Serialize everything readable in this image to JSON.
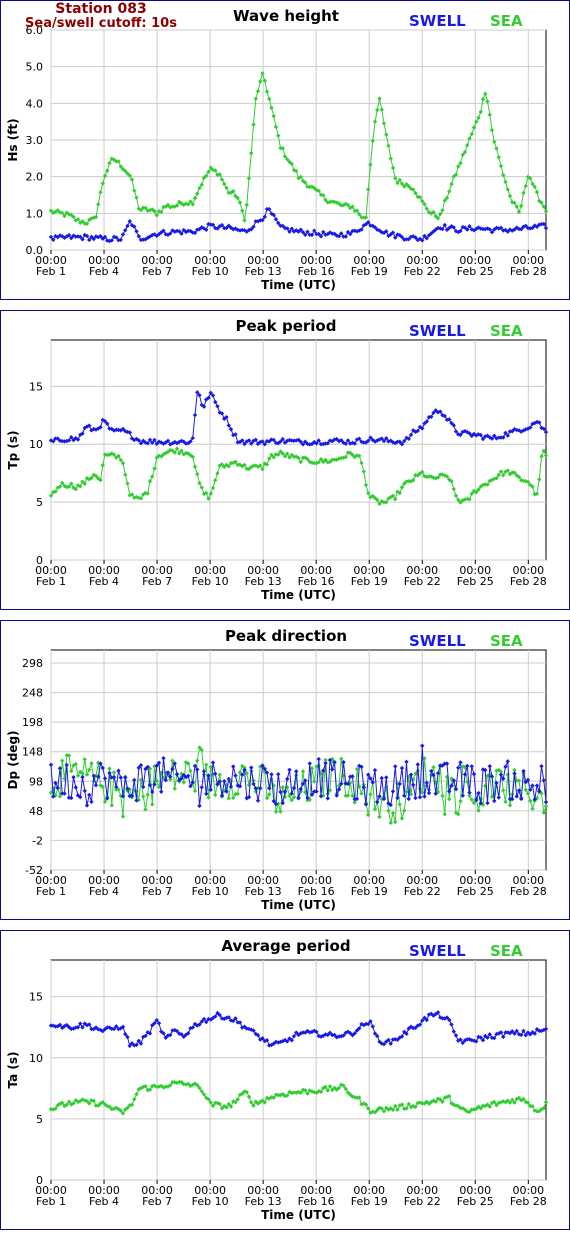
{
  "station": {
    "name": "Station 083",
    "cutoff": "Sea/swell cutoff: 10s"
  },
  "legend": {
    "swell": "SWELL",
    "sea": "SEA",
    "swell_color": "#1a1ae6",
    "sea_color": "#33cc33"
  },
  "x_axis": {
    "label": "Time (UTC)",
    "ticks": [
      {
        "time": "00:00",
        "date": "Feb 1",
        "day": 0
      },
      {
        "time": "00:00",
        "date": "Feb 4",
        "day": 3
      },
      {
        "time": "00:00",
        "date": "Feb 7",
        "day": 6
      },
      {
        "time": "00:00",
        "date": "Feb 10",
        "day": 9
      },
      {
        "time": "00:00",
        "date": "Feb 13",
        "day": 12
      },
      {
        "time": "00:00",
        "date": "Feb 16",
        "day": 15
      },
      {
        "time": "00:00",
        "date": "Feb 19",
        "day": 18
      },
      {
        "time": "00:00",
        "date": "Feb 22",
        "day": 21
      },
      {
        "time": "00:00",
        "date": "Feb 25",
        "day": 24
      },
      {
        "time": "00:00",
        "date": "Feb 28",
        "day": 27
      }
    ],
    "range_days": [
      0,
      28
    ]
  },
  "chart_data": [
    {
      "type": "line",
      "title": "Wave height",
      "ylabel": "Hs (ft)",
      "ylim": [
        0,
        6
      ],
      "yticks": [
        "0.0",
        "1.0",
        "2.0",
        "3.0",
        "4.0",
        "5.0",
        "6.0"
      ],
      "ytick_values": [
        0,
        1,
        2,
        3,
        4,
        5,
        6
      ],
      "grid": true,
      "legend": "top-right",
      "series": [
        {
          "name": "SWELL",
          "x": [
            0,
            1,
            2,
            3,
            4,
            4.5,
            5,
            6,
            7,
            8,
            9,
            10,
            11,
            12,
            12.3,
            13,
            14,
            15,
            16,
            17,
            18,
            19,
            20,
            21,
            22,
            23,
            24,
            25,
            26,
            27,
            28
          ],
          "values": [
            0.3,
            0.35,
            0.35,
            0.3,
            0.3,
            0.8,
            0.3,
            0.45,
            0.5,
            0.5,
            0.65,
            0.6,
            0.5,
            0.9,
            1.1,
            0.6,
            0.5,
            0.45,
            0.4,
            0.45,
            0.75,
            0.45,
            0.35,
            0.3,
            0.65,
            0.55,
            0.6,
            0.55,
            0.55,
            0.6,
            0.65
          ]
        },
        {
          "name": "SEA",
          "x": [
            0,
            0.5,
            1,
            1.5,
            2,
            2.5,
            3,
            3.5,
            4,
            4.5,
            5,
            5.5,
            6,
            6.5,
            7,
            7.5,
            8,
            8.5,
            9,
            9.5,
            10,
            10.5,
            11,
            11.3,
            11.6,
            12,
            12.3,
            12.6,
            13,
            13.5,
            14,
            14.5,
            15,
            15.5,
            16,
            16.5,
            17,
            17.4,
            17.8,
            18,
            18.3,
            18.6,
            19,
            19.5,
            20,
            20.5,
            21,
            21.5,
            22,
            22.5,
            23,
            23.5,
            24,
            24.3,
            24.6,
            25,
            25.5,
            26,
            26.5,
            27,
            27.5,
            28
          ],
          "values": [
            1.05,
            1.0,
            0.95,
            0.8,
            0.75,
            0.85,
            2.0,
            2.5,
            2.3,
            2.0,
            1.1,
            1.1,
            1.0,
            1.2,
            1.2,
            1.3,
            1.3,
            1.8,
            2.2,
            2.1,
            1.6,
            1.5,
            0.8,
            2.5,
            4.2,
            4.8,
            4.2,
            3.6,
            2.8,
            2.4,
            2.0,
            1.8,
            1.6,
            1.4,
            1.3,
            1.2,
            1.2,
            1.0,
            0.8,
            2.0,
            3.5,
            4.1,
            3.0,
            1.9,
            1.8,
            1.7,
            1.3,
            1.0,
            0.9,
            1.6,
            2.2,
            2.8,
            3.4,
            3.8,
            4.4,
            3.1,
            2.2,
            1.4,
            1.0,
            2.1,
            1.5,
            1.1
          ]
        }
      ]
    },
    {
      "type": "line",
      "title": "Peak period",
      "ylabel": "Tp (s)",
      "ylim": [
        0,
        19
      ],
      "yticks": [
        "0",
        "5",
        "10",
        "15"
      ],
      "ytick_values": [
        0,
        5,
        10,
        15
      ],
      "grid": true,
      "legend": "top-right",
      "series": [
        {
          "name": "SWELL",
          "x": [
            0,
            1,
            1.5,
            2,
            2.5,
            3,
            3.5,
            4,
            4.5,
            5,
            6,
            7,
            8,
            8.3,
            8.6,
            9,
            9.5,
            10,
            10.3,
            10.6,
            11,
            12,
            13,
            14,
            15,
            16,
            17,
            18,
            19,
            20,
            20.5,
            21,
            21.5,
            22,
            22.5,
            23,
            24,
            25,
            26,
            27,
            27.5,
            28
          ],
          "values": [
            10.2,
            10.5,
            10.4,
            11.5,
            11.2,
            12,
            11,
            11.2,
            10.8,
            10.3,
            10.2,
            10.2,
            10.2,
            15,
            13,
            14.5,
            13,
            12,
            11,
            10.3,
            10.2,
            10.2,
            10.3,
            10.2,
            10.2,
            10.3,
            10.2,
            10.4,
            10.3,
            10.2,
            11,
            11.5,
            12.5,
            13,
            12,
            11,
            10.8,
            10.5,
            11,
            11.5,
            12,
            11
          ]
        },
        {
          "name": "SEA",
          "x": [
            0,
            0.5,
            1,
            1.5,
            2,
            2.5,
            2.8,
            3,
            3.5,
            4,
            4.5,
            5,
            5.5,
            6,
            7,
            8,
            8.3,
            8.6,
            9,
            9.5,
            10,
            10.5,
            11,
            12,
            12.5,
            13,
            14,
            15,
            16,
            17,
            17.5,
            18,
            18.5,
            19,
            19.5,
            20,
            20.5,
            21,
            21.5,
            22,
            22.5,
            23,
            23.5,
            24,
            24.5,
            25,
            25.5,
            26,
            26.5,
            27,
            27.5,
            27.8,
            28
          ],
          "values": [
            5.5,
            6.5,
            6.5,
            6.3,
            6.8,
            7.5,
            6.8,
            9,
            9,
            8.8,
            5.5,
            5.2,
            6,
            9,
            9.5,
            9.2,
            7,
            5.8,
            5.4,
            8,
            8.2,
            8.5,
            8.0,
            8.0,
            9,
            9.2,
            8.7,
            8.5,
            8.6,
            9.2,
            8.8,
            5.5,
            5.0,
            5.0,
            5.5,
            6.5,
            7.0,
            7.5,
            7.0,
            7.2,
            7.2,
            5.2,
            5.0,
            6.0,
            6.5,
            7.0,
            7.5,
            7.6,
            7.0,
            6.8,
            5.5,
            9.5,
            9.0
          ]
        }
      ]
    },
    {
      "type": "scatter",
      "title": "Peak direction",
      "ylabel": "Dp (deg)",
      "ylim": [
        -52,
        320
      ],
      "yticks": [
        "-52",
        "-2",
        "48",
        "98",
        "148",
        "198",
        "248",
        "298"
      ],
      "ytick_values": [
        -52,
        -2,
        48,
        98,
        148,
        198,
        248,
        298
      ],
      "grid": true,
      "legend": "top-right",
      "series": [
        {
          "name": "SWELL",
          "x": [
            0,
            1,
            2,
            3,
            4,
            5,
            6,
            7,
            8,
            9,
            10,
            11,
            12,
            13,
            14,
            15,
            16,
            17,
            18,
            19,
            20,
            21,
            22,
            23,
            24,
            25,
            26,
            27,
            28
          ],
          "values": [
            95,
            100,
            90,
            105,
            85,
            100,
            110,
            95,
            105,
            100,
            110,
            95,
            100,
            85,
            100,
            105,
            100,
            95,
            90,
            85,
            100,
            105,
            95,
            100,
            90,
            95,
            100,
            85,
            95
          ]
        },
        {
          "name": "SEA",
          "x": [
            0,
            1,
            2,
            3,
            4,
            5,
            6,
            7,
            8,
            9,
            10,
            11,
            12,
            13,
            14,
            15,
            16,
            17,
            18,
            19,
            20,
            21,
            22,
            23,
            24,
            25,
            26,
            27,
            28
          ],
          "values": [
            100,
            110,
            105,
            95,
            75,
            70,
            100,
            105,
            110,
            95,
            100,
            110,
            90,
            60,
            80,
            95,
            110,
            100,
            70,
            60,
            65,
            110,
            100,
            75,
            70,
            90,
            85,
            80,
            70
          ]
        }
      ]
    },
    {
      "type": "line",
      "title": "Average period",
      "ylabel": "Ta (s)",
      "ylim": [
        0,
        18
      ],
      "yticks": [
        "0",
        "5",
        "10",
        "15"
      ],
      "ytick_values": [
        0,
        5,
        10,
        15
      ],
      "grid": true,
      "legend": "top-right",
      "series": [
        {
          "name": "SWELL",
          "x": [
            0,
            1,
            2,
            3,
            4,
            4.5,
            5,
            5.5,
            6,
            6.5,
            7,
            7.5,
            8,
            8.5,
            9,
            9.5,
            10,
            10.5,
            11,
            11.5,
            12,
            12.5,
            13,
            13.5,
            14,
            15,
            16,
            17,
            17.5,
            18,
            18.5,
            19,
            19.5,
            20,
            20.5,
            21,
            21.5,
            22,
            22.5,
            23,
            23.5,
            24,
            25,
            26,
            27,
            28
          ],
          "values": [
            12.8,
            12.5,
            12.7,
            12.2,
            12.6,
            11.0,
            11.2,
            12.0,
            13.0,
            11.5,
            12.2,
            11.8,
            12.5,
            13.0,
            13.2,
            13.5,
            13.3,
            13.0,
            12.5,
            12.0,
            11.5,
            11.0,
            11.2,
            11.5,
            12.0,
            12.0,
            11.8,
            12.0,
            12.5,
            13.0,
            11.5,
            11.2,
            11.5,
            12.0,
            12.5,
            13.0,
            13.5,
            13.5,
            13.0,
            11.5,
            11.3,
            11.5,
            11.8,
            12.0,
            12.0,
            12.3
          ]
        },
        {
          "name": "SEA",
          "x": [
            0,
            1,
            2,
            3,
            4,
            4.5,
            5,
            6,
            7,
            8,
            8.5,
            9,
            10,
            10.5,
            11,
            11.5,
            12,
            12.5,
            13,
            14,
            15,
            16,
            16.5,
            17,
            17.5,
            18,
            19,
            20,
            21,
            22,
            22.5,
            23,
            23.5,
            24,
            25,
            26,
            26.5,
            27,
            27.5,
            28
          ],
          "values": [
            5.8,
            6.3,
            6.4,
            6.2,
            5.5,
            6.0,
            7.5,
            7.6,
            7.9,
            7.8,
            7.5,
            6.2,
            6.0,
            6.5,
            7.2,
            6.2,
            6.5,
            6.8,
            7.0,
            7.2,
            7.3,
            7.5,
            7.6,
            7.0,
            6.5,
            5.7,
            5.8,
            6.0,
            6.3,
            6.5,
            6.7,
            6.0,
            5.5,
            5.8,
            6.2,
            6.5,
            6.6,
            6.4,
            5.6,
            6.2
          ]
        }
      ]
    }
  ]
}
